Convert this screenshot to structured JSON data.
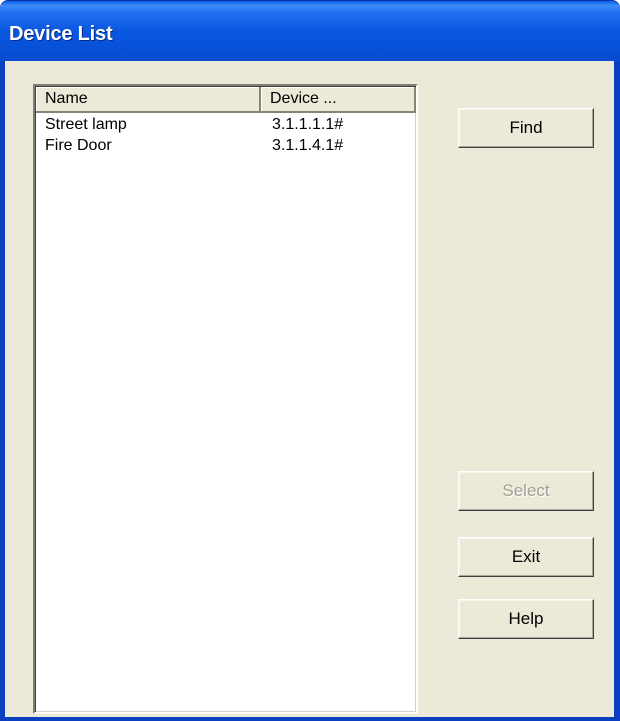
{
  "window": {
    "title": "Device List"
  },
  "listview": {
    "columns": [
      "Name",
      "Device ..."
    ],
    "rows": [
      {
        "name": "Street lamp",
        "device": "3.1.1.1.1#"
      },
      {
        "name": "Fire Door",
        "device": "3.1.1.4.1#"
      }
    ]
  },
  "buttons": {
    "find": "Find",
    "select": "Select",
    "exit": "Exit",
    "help": "Help"
  },
  "colors": {
    "titlebar": "#0b58e0",
    "dialog_background": "#ece9d8",
    "disabled_text": "#a19e92"
  }
}
